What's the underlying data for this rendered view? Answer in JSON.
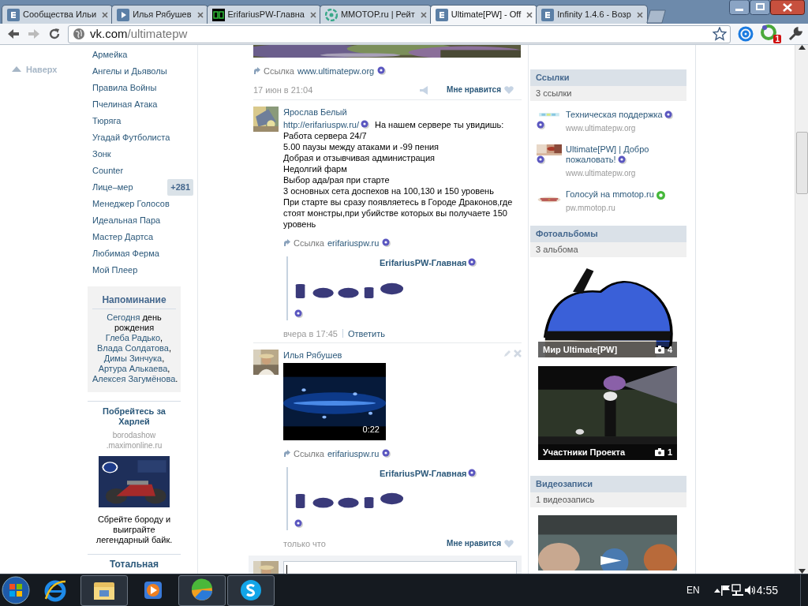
{
  "browser": {
    "tabs": [
      {
        "title": "Сообщества Ильи",
        "selected": false
      },
      {
        "title": "Илья Рябушев",
        "selected": false
      },
      {
        "title": "ErifariusPW-Главна",
        "selected": false
      },
      {
        "title": "MMOTOP.ru | Рейт",
        "selected": false
      },
      {
        "title": "Ultimate[PW] - Off",
        "selected": true
      },
      {
        "title": "Infinity 1.4.6 - Возр",
        "selected": false
      }
    ],
    "address": {
      "host": "vk.com",
      "path": "/ultimatepw"
    },
    "extension_badge": "1"
  },
  "page": {
    "back_to_top": "Наверх",
    "menu": [
      {
        "label": "Армейка"
      },
      {
        "label": "Ангелы и Дьяволы"
      },
      {
        "label": "Правила Войны"
      },
      {
        "label": "Пчелиная Атака"
      },
      {
        "label": "Тюряга"
      },
      {
        "label": "Угадай Футболиста"
      },
      {
        "label": "Зонк"
      },
      {
        "label": "Counter"
      },
      {
        "label": "Лице–мер",
        "badge": "+281"
      },
      {
        "label": "Менеджер Голосов"
      },
      {
        "label": "Идеальная Пара"
      },
      {
        "label": "Мастер Дартса"
      },
      {
        "label": "Любимая Ферма"
      },
      {
        "label": "Мой Плеер"
      }
    ],
    "reminder": {
      "title": "Напоминание",
      "parts": [
        {
          "text": "Сегодня",
          "kind": "link"
        },
        {
          "text": " день рождения ",
          "kind": "plain"
        },
        {
          "text": "Глеба Радько",
          "kind": "link"
        },
        {
          "text": ", ",
          "kind": "plain"
        },
        {
          "text": "Влада Солдатова",
          "kind": "link"
        },
        {
          "text": ", ",
          "kind": "plain"
        },
        {
          "text": "Димы Зинчука",
          "kind": "link"
        },
        {
          "text": ", ",
          "kind": "plain"
        },
        {
          "text": "Артура Алькаева",
          "kind": "link"
        },
        {
          "text": ", ",
          "kind": "plain"
        },
        {
          "text": "Алексея Загумёнова",
          "kind": "link"
        },
        {
          "text": ".",
          "kind": "plain"
        }
      ]
    },
    "ad": {
      "title": "Побрейтесь за Харлей",
      "source": [
        "borodashow",
        ".maximonline.ru"
      ],
      "text": "Сбрейте бороду и выиграйте легендарный байк."
    },
    "next_ad": {
      "title": "Тотальная"
    },
    "wall": [
      {
        "link": {
          "label": "Ссылка",
          "url": "www.ultimatepw.org"
        },
        "date": "17 июн в 21:04",
        "share_icon": true,
        "like": "Мне нравится"
      },
      {
        "author": "Ярослав Белый",
        "url": "http://erifariuspw.ru/",
        "lines": [
          "На нашем сервере ты увидишь:",
          "Работа сервера 24/7",
          "5.00 паузы между атаками и -99 пения",
          "Добрая и отзывчивая администрация",
          "Недолгий фарм",
          "Выбор ада/рая при старте",
          "3 основных сета доспехов на 100,130 и 150 уровень",
          "При старте вы сразу появляетесь в Городе Драконов,где стоят монстры,при убийстве которых вы получаете 150 уровень"
        ],
        "link": {
          "label": "Ссылка",
          "url": "erifariuspw.ru"
        },
        "preview": {
          "title": "ErifariusPW-Главная"
        },
        "date": "вчера в 17:45",
        "reply": "Ответить"
      },
      {
        "author": "Илья Рябушев",
        "editable": true,
        "video": {
          "duration": "0:22"
        },
        "link": {
          "label": "Ссылка",
          "url": "erifariuspw.ru"
        },
        "preview": {
          "title": "ErifariusPW-Главная"
        },
        "date": "только что",
        "like": "Мне нравится"
      }
    ],
    "comment_box": {
      "focused": true
    },
    "sidebar": {
      "links": {
        "title": "Ссылки",
        "count": "3 ссылки",
        "items": [
          {
            "title": "Техническая поддержка",
            "url": "www.ultimatepw.org",
            "kind": "question"
          },
          {
            "title": "Ultimate[PW] | Добро пожаловать!",
            "url": "www.ultimatepw.org",
            "kind": "question"
          },
          {
            "title": "Голосуй на mmotop.ru",
            "url": "pw.mmotop.ru",
            "kind": "check"
          }
        ]
      },
      "albums": {
        "title": "Фотоальбомы",
        "count": "3 альбома",
        "items": [
          {
            "title": "Мир Ultimate[PW]",
            "count": "4"
          },
          {
            "title": "Участники Проекта",
            "count": "1"
          }
        ]
      },
      "videos": {
        "title": "Видеозаписи",
        "count": "1 видеозапись"
      }
    }
  },
  "taskbar": {
    "apps": [
      {
        "kind": "ie",
        "running": false
      },
      {
        "kind": "explorer",
        "running": true
      },
      {
        "kind": "media",
        "running": false
      },
      {
        "kind": "ball",
        "running": true
      },
      {
        "kind": "skype",
        "running": true
      }
    ],
    "language": "EN",
    "time": "4:55"
  }
}
